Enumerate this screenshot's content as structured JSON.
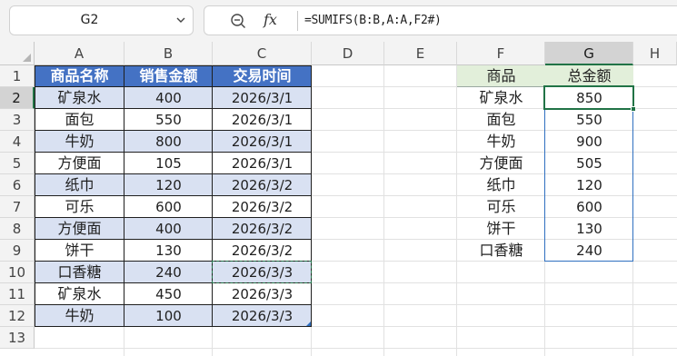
{
  "name_box": {
    "value": "G2"
  },
  "formula_bar": {
    "fx_label": "fx",
    "formula": "=SUMIFS(B:B,A:A,F2#)"
  },
  "columns": [
    "A",
    "B",
    "C",
    "D",
    "E",
    "F",
    "G",
    "H"
  ],
  "rows": [
    "1",
    "2",
    "3",
    "4",
    "5",
    "6",
    "7",
    "8",
    "9",
    "10",
    "11",
    "12",
    "13"
  ],
  "selected": {
    "column": "G",
    "row": "2"
  },
  "sales_table": {
    "headers": [
      "商品名称",
      "销售金额",
      "交易时间"
    ],
    "rows": [
      [
        "矿泉水",
        "400",
        "2026/3/1"
      ],
      [
        "面包",
        "550",
        "2026/3/1"
      ],
      [
        "牛奶",
        "800",
        "2026/3/1"
      ],
      [
        "方便面",
        "105",
        "2026/3/1"
      ],
      [
        "纸巾",
        "120",
        "2026/3/2"
      ],
      [
        "可乐",
        "600",
        "2026/3/2"
      ],
      [
        "方便面",
        "400",
        "2026/3/2"
      ],
      [
        "饼干",
        "130",
        "2026/3/2"
      ],
      [
        "口香糖",
        "240",
        "2026/3/3"
      ],
      [
        "矿泉水",
        "450",
        "2026/3/3"
      ],
      [
        "牛奶",
        "100",
        "2026/3/3"
      ]
    ]
  },
  "summary_table": {
    "headers": [
      "商品",
      "总金额"
    ],
    "rows": [
      [
        "矿泉水",
        "850"
      ],
      [
        "面包",
        "550"
      ],
      [
        "牛奶",
        "900"
      ],
      [
        "方便面",
        "505"
      ],
      [
        "纸巾",
        "120"
      ],
      [
        "可乐",
        "600"
      ],
      [
        "饼干",
        "130"
      ],
      [
        "口香糖",
        "240"
      ]
    ]
  },
  "colors": {
    "table_header": "#4472c4",
    "band": "#d9e1f2",
    "summary_header": "#e2efda",
    "selection": "#217346",
    "range_highlight": "#2f6fc0"
  },
  "icons": {
    "name_box_dropdown": "chevron-down-icon",
    "formula_search": "zoom-out-icon"
  }
}
